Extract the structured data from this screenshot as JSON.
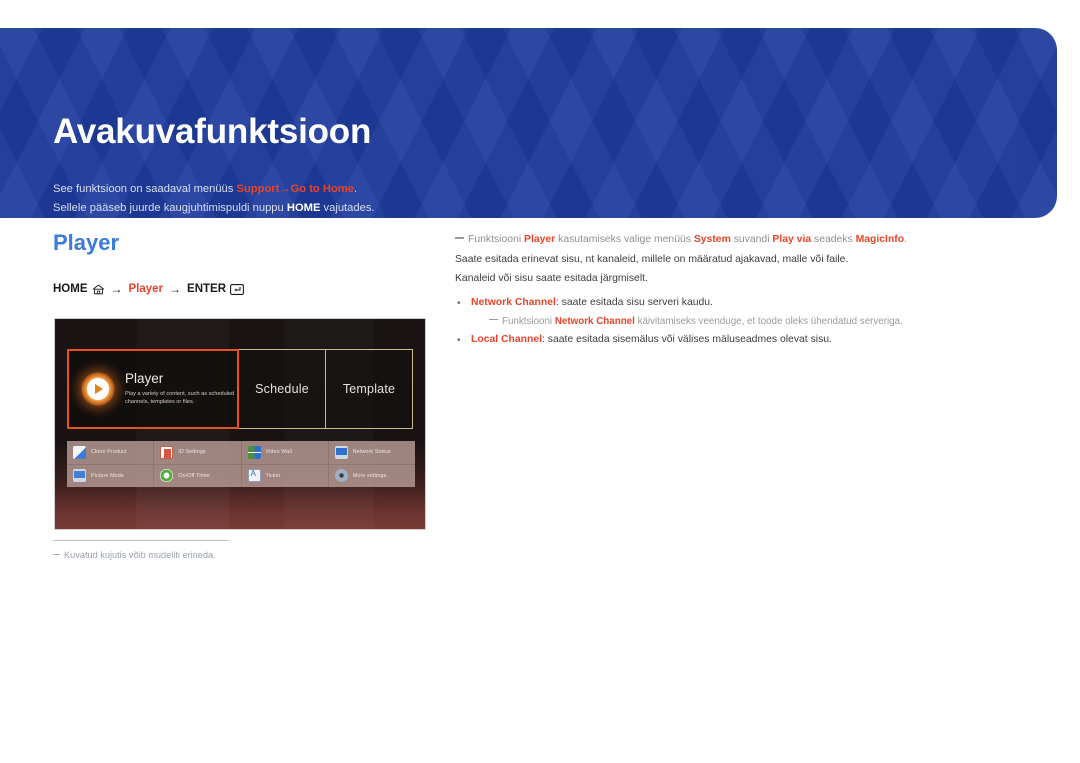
{
  "banner": {
    "title": "Avakuvafunktsioon",
    "sub_line1_pre": "See funktsioon on saadaval menüüs ",
    "sub_line1_m1": "Support",
    "sub_line1_arrow": "→",
    "sub_line1_m2": "Go to Home",
    "sub_line1_post": ".",
    "sub_line2_pre": "Sellele pääseb juurde kaugjuhtimispuldi nuppu ",
    "sub_line2_key": "HOME",
    "sub_line2_post": " vajutades."
  },
  "left": {
    "section_title": "Player",
    "breadcrumb": {
      "home": "HOME",
      "home_icon": "home-icon",
      "arrow1": "→",
      "player": "Player",
      "arrow2": "→",
      "enter": "ENTER",
      "enter_icon": "enter-key-icon"
    },
    "image_note": "Kuvatud kujutis võib mudeliti erineda."
  },
  "tv_screen": {
    "tiles": [
      {
        "name": "Player",
        "label": "Player",
        "description": "Play a variety of content, such as scheduled channels, templates or files.",
        "selected": true,
        "icon": "play-circle-icon"
      },
      {
        "name": "Schedule",
        "label": "Schedule",
        "description": "",
        "selected": false,
        "icon": ""
      },
      {
        "name": "Template",
        "label": "Template",
        "description": "",
        "selected": false,
        "icon": ""
      }
    ],
    "grid_items": [
      {
        "label": "Clone Product",
        "icon": "clone-product-icon"
      },
      {
        "label": "ID Settings",
        "icon": "id-settings-icon"
      },
      {
        "label": "Video Wall",
        "icon": "video-wall-icon"
      },
      {
        "label": "Network Status",
        "icon": "network-status-icon"
      },
      {
        "label": "Picture Mode",
        "icon": "picture-mode-icon"
      },
      {
        "label": "On/Off Timer",
        "icon": "on-off-timer-icon"
      },
      {
        "label": "Ticker",
        "icon": "ticker-icon"
      },
      {
        "label": "More settings",
        "icon": "more-settings-icon"
      }
    ]
  },
  "right": {
    "note1_pre": "Funktsiooni ",
    "note1_m1": "Player",
    "note1_mid1": " kasutamiseks valige menüüs ",
    "note1_m2": "System",
    "note1_mid2": " suvandi ",
    "note1_m3": "Play via",
    "note1_mid3": " seadeks ",
    "note1_m4": "MagicInfo",
    "note1_post": ".",
    "body1": "Saate esitada erinevat sisu, nt kanaleid, millele on määratud ajakavad, malle või faile.",
    "body2": "Kanaleid või sisu saate esitada järgmiselt.",
    "bullet1_label": "Network Channel",
    "bullet1_text": ": saate esitada sisu serveri kaudu.",
    "subnote_pre": "Funktsiooni ",
    "subnote_m1": "Network Channel",
    "subnote_post": " käivitamiseks veenduge, et toode oleks ühendatud serveriga.",
    "bullet2_label": "Local Channel",
    "bullet2_text": ": saate esitada sisemälus või välises mäluseadmes olevat sisu."
  },
  "colors": {
    "banner_blue": "#1f3d9e",
    "accent_red": "#e8442a",
    "section_blue": "#3a7bdb",
    "tile_select": "#e8521c"
  }
}
